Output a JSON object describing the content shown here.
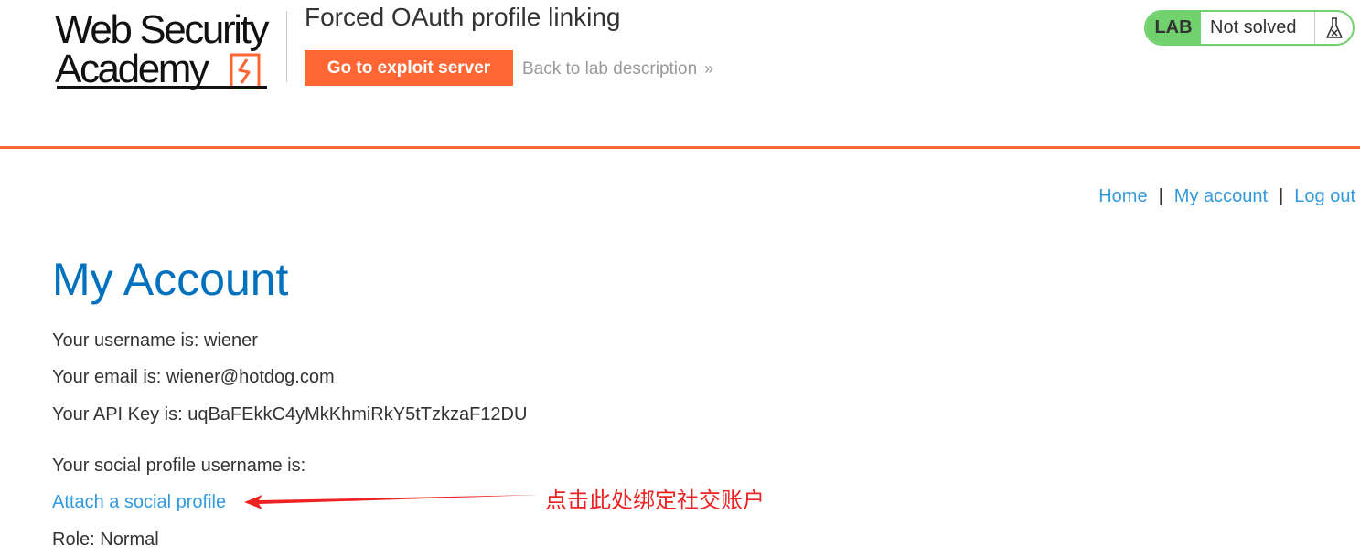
{
  "logo": {
    "line1": "Web Security",
    "line2": "Academy"
  },
  "lab": {
    "title": "Forced OAuth profile linking",
    "exploit_button": "Go to exploit server",
    "back_link": "Back to lab description",
    "back_chevron": "»",
    "status_tag": "LAB",
    "status_text": "Not solved",
    "status_icon": "flask-icon"
  },
  "nav": {
    "home": "Home",
    "separator": "|",
    "my_account": "My account",
    "log_out": "Log out"
  },
  "account": {
    "title": "My Account",
    "username_line": "Your username is: wiener",
    "email_line": "Your email is: wiener@hotdog.com",
    "api_key_line": "Your API Key is: uqBaFEkkC4yMkKhmiRkY5tTzkzaF12DU",
    "social_line": "Your social profile username is:",
    "attach_link": "Attach a social profile",
    "role_line": "Role: Normal"
  },
  "annotation": {
    "text": "点击此处绑定社交账户",
    "color": "#ee2222"
  },
  "colors": {
    "accent": "#ff6633",
    "link": "#3399dd",
    "title_blue": "#0071bc",
    "lab_green": "#70d16d"
  }
}
